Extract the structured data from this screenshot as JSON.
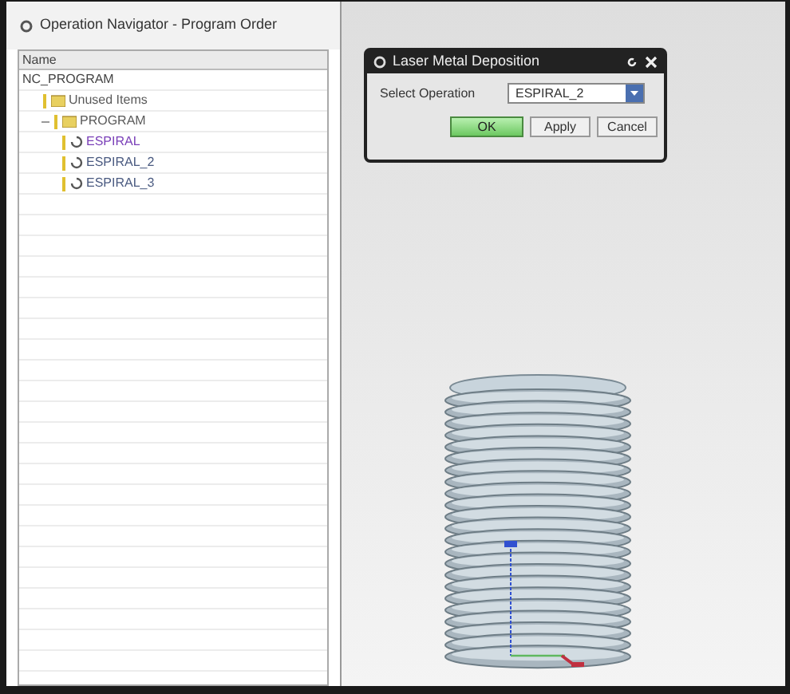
{
  "navigator": {
    "title": "Operation Navigator - Program Order",
    "columns": [
      "Name"
    ],
    "tree": [
      {
        "label": "NC_PROGRAM",
        "kind": "root",
        "children": [
          {
            "label": "Unused Items",
            "kind": "group"
          },
          {
            "label": "PROGRAM",
            "kind": "group",
            "expanded": true,
            "children": [
              {
                "label": "ESPIRAL",
                "kind": "operation",
                "selected": true
              },
              {
                "label": "ESPIRAL_2",
                "kind": "operation",
                "selected": false
              },
              {
                "label": "ESPIRAL_3",
                "kind": "operation",
                "selected": false
              }
            ]
          }
        ]
      }
    ]
  },
  "dialog": {
    "title": "Laser Metal Deposition",
    "field_label": "Select Operation",
    "value": "ESPIRAL_2",
    "buttons": [
      {
        "label": "OK",
        "kind": "primary"
      },
      {
        "label": "Apply",
        "kind": "normal"
      },
      {
        "label": "Cancel",
        "kind": "normal"
      }
    ]
  }
}
